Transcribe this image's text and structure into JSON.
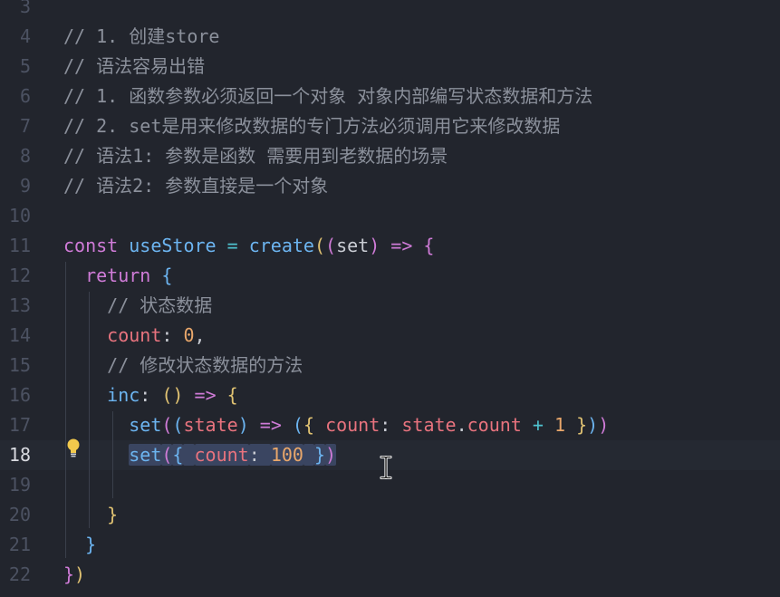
{
  "editor": {
    "active_line": "18",
    "lines": [
      {
        "n": "3",
        "tokens": []
      },
      {
        "n": "4",
        "tokens": [
          {
            "t": "// 1. 创建store",
            "c": "cm"
          }
        ]
      },
      {
        "n": "5",
        "tokens": [
          {
            "t": "// 语法容易出错",
            "c": "cm"
          }
        ]
      },
      {
        "n": "6",
        "tokens": [
          {
            "t": "// 1. 函数参数必须返回一个对象 对象内部编写状态数据和方法",
            "c": "cm"
          }
        ]
      },
      {
        "n": "7",
        "tokens": [
          {
            "t": "// 2. set是用来修改数据的专门方法必须调用它来修改数据",
            "c": "cm"
          }
        ]
      },
      {
        "n": "8",
        "tokens": [
          {
            "t": "// 语法1: 参数是函数 需要用到老数据的场景",
            "c": "cm"
          }
        ]
      },
      {
        "n": "9",
        "tokens": [
          {
            "t": "// 语法2: 参数直接是一个对象",
            "c": "cm"
          }
        ]
      },
      {
        "n": "10",
        "tokens": []
      },
      {
        "n": "11",
        "tokens": [
          {
            "t": "const ",
            "c": "kw"
          },
          {
            "t": "useStore",
            "c": "fn"
          },
          {
            "t": " ",
            "c": "pl"
          },
          {
            "t": "=",
            "c": "op"
          },
          {
            "t": " ",
            "c": "pl"
          },
          {
            "t": "create",
            "c": "fn"
          },
          {
            "t": "(",
            "c": "br1"
          },
          {
            "t": "(",
            "c": "br2"
          },
          {
            "t": "set",
            "c": "pl"
          },
          {
            "t": ")",
            "c": "br2"
          },
          {
            "t": " ",
            "c": "pl"
          },
          {
            "t": "=>",
            "c": "kw"
          },
          {
            "t": " ",
            "c": "pl"
          },
          {
            "t": "{",
            "c": "br2"
          }
        ]
      },
      {
        "n": "12",
        "tokens": [
          {
            "t": "  ",
            "c": "pl"
          },
          {
            "t": "return",
            "c": "kw"
          },
          {
            "t": " ",
            "c": "pl"
          },
          {
            "t": "{",
            "c": "br3"
          }
        ]
      },
      {
        "n": "13",
        "tokens": [
          {
            "t": "    ",
            "c": "pl"
          },
          {
            "t": "// 状态数据",
            "c": "cm"
          }
        ]
      },
      {
        "n": "14",
        "tokens": [
          {
            "t": "    ",
            "c": "pl"
          },
          {
            "t": "count",
            "c": "pr"
          },
          {
            "t": ": ",
            "c": "pl"
          },
          {
            "t": "0",
            "c": "num"
          },
          {
            "t": ",",
            "c": "pl"
          }
        ]
      },
      {
        "n": "15",
        "tokens": [
          {
            "t": "    ",
            "c": "pl"
          },
          {
            "t": "// 修改状态数据的方法",
            "c": "cm"
          }
        ]
      },
      {
        "n": "16",
        "tokens": [
          {
            "t": "    ",
            "c": "pl"
          },
          {
            "t": "inc",
            "c": "fn"
          },
          {
            "t": ": ",
            "c": "pl"
          },
          {
            "t": "()",
            "c": "br1"
          },
          {
            "t": " ",
            "c": "pl"
          },
          {
            "t": "=>",
            "c": "kw"
          },
          {
            "t": " ",
            "c": "pl"
          },
          {
            "t": "{",
            "c": "br1"
          }
        ]
      },
      {
        "n": "17",
        "tokens": [
          {
            "t": "      ",
            "c": "pl"
          },
          {
            "t": "set",
            "c": "fn"
          },
          {
            "t": "(",
            "c": "br2"
          },
          {
            "t": "(",
            "c": "br3"
          },
          {
            "t": "state",
            "c": "pr"
          },
          {
            "t": ")",
            "c": "br3"
          },
          {
            "t": " ",
            "c": "pl"
          },
          {
            "t": "=>",
            "c": "kw"
          },
          {
            "t": " ",
            "c": "pl"
          },
          {
            "t": "(",
            "c": "br3"
          },
          {
            "t": "{",
            "c": "br1"
          },
          {
            "t": " ",
            "c": "pl"
          },
          {
            "t": "count",
            "c": "pr"
          },
          {
            "t": ": ",
            "c": "pl"
          },
          {
            "t": "state",
            "c": "pr"
          },
          {
            "t": ".",
            "c": "pl"
          },
          {
            "t": "count",
            "c": "pr"
          },
          {
            "t": " ",
            "c": "pl"
          },
          {
            "t": "+",
            "c": "op"
          },
          {
            "t": " ",
            "c": "pl"
          },
          {
            "t": "1",
            "c": "num"
          },
          {
            "t": " ",
            "c": "pl"
          },
          {
            "t": "}",
            "c": "br1"
          },
          {
            "t": ")",
            "c": "br3"
          },
          {
            "t": ")",
            "c": "br2"
          }
        ]
      },
      {
        "n": "18",
        "tokens": [
          {
            "t": "      ",
            "c": "pl"
          },
          {
            "t": "set",
            "c": "fn",
            "sel": true
          },
          {
            "t": "(",
            "c": "br2",
            "sel": true
          },
          {
            "t": "{",
            "c": "br3",
            "sel": true
          },
          {
            "t": " ",
            "c": "pl",
            "sel": true
          },
          {
            "t": "count",
            "c": "pr",
            "sel": true
          },
          {
            "t": ": ",
            "c": "pl",
            "sel": true
          },
          {
            "t": "100",
            "c": "num",
            "sel": true
          },
          {
            "t": " ",
            "c": "pl",
            "sel": true
          },
          {
            "t": "}",
            "c": "br3",
            "sel": true
          },
          {
            "t": ")",
            "c": "br2",
            "sel": true
          }
        ]
      },
      {
        "n": "19",
        "tokens": []
      },
      {
        "n": "20",
        "tokens": [
          {
            "t": "    ",
            "c": "pl"
          },
          {
            "t": "}",
            "c": "br1"
          }
        ]
      },
      {
        "n": "21",
        "tokens": [
          {
            "t": "  ",
            "c": "pl"
          },
          {
            "t": "}",
            "c": "br3"
          }
        ]
      },
      {
        "n": "22",
        "tokens": [
          {
            "t": "}",
            "c": "br2"
          },
          {
            "t": ")",
            "c": "br1"
          }
        ]
      }
    ]
  },
  "icons": {
    "lightbulb": "lightbulb-icon",
    "cursor": "text-cursor-icon"
  },
  "colors": {
    "background": "#22252d",
    "comment": "#8b909b",
    "keyword": "#cf7bd7",
    "function": "#6cb4f0",
    "property": "#e8737e",
    "number": "#e9a76b",
    "bulb": "#f2c94c"
  }
}
